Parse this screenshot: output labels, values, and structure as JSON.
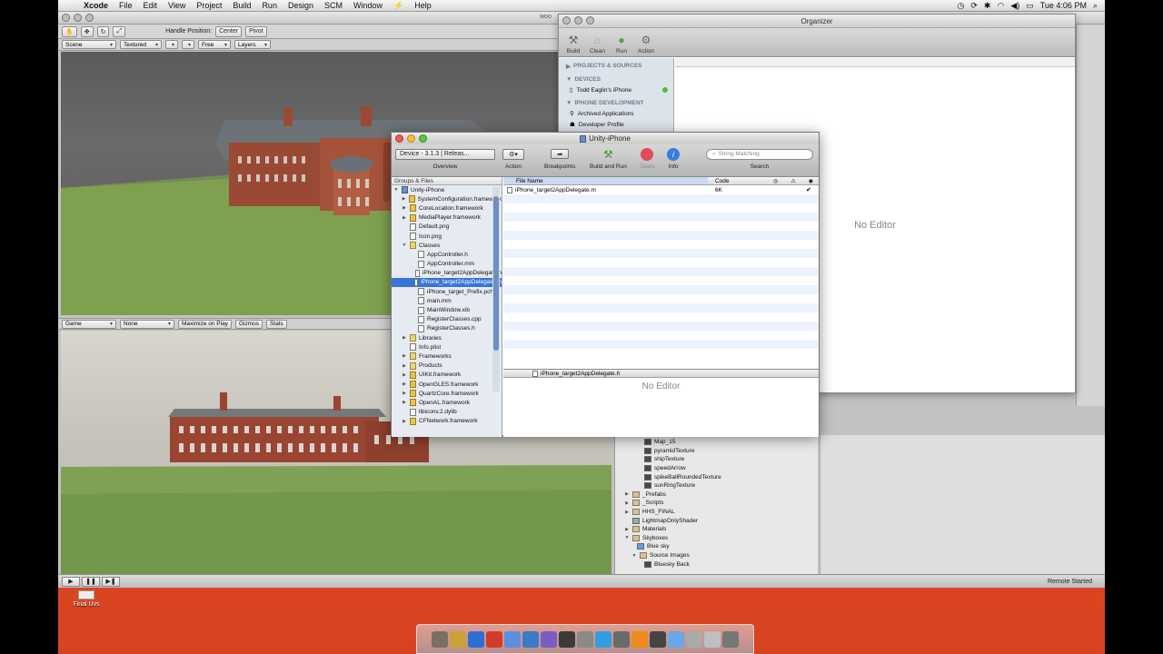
{
  "menubar": {
    "app": "Xcode",
    "items": [
      "File",
      "Edit",
      "View",
      "Project",
      "Build",
      "Run",
      "Design",
      "SCM",
      "Window",
      "Help"
    ],
    "clock": "Tue 4:06 PM"
  },
  "unity": {
    "tab_title": "woo",
    "handle_position_label": "Handle Position:",
    "center_btn": "Center",
    "pivot_btn": "Pivot",
    "scene_view": {
      "mode": "Scene",
      "shading": "Textured",
      "free": "Free",
      "layers": "Layers"
    },
    "game_view": {
      "mode": "Game",
      "aspect": "None",
      "maximize": "Maximize on Play",
      "gizmos": "Gizmos",
      "stats": "Stats"
    },
    "status": "Remote Started",
    "project_items": [
      {
        "label": "Map_15",
        "kind": "tex"
      },
      {
        "label": "pyramidTexture",
        "kind": "tex"
      },
      {
        "label": "shipTexture",
        "kind": "tex"
      },
      {
        "label": "speedArrow",
        "kind": "tex"
      },
      {
        "label": "spikeBallRoundedTexture",
        "kind": "tex"
      },
      {
        "label": "sunRingTexture",
        "kind": "tex"
      },
      {
        "label": "_Prefabs",
        "kind": "folder"
      },
      {
        "label": "_Scripts",
        "kind": "folder"
      },
      {
        "label": "HHS_FINAL",
        "kind": "folder"
      },
      {
        "label": "LightmapOnlyShader",
        "kind": "file"
      },
      {
        "label": "Materials",
        "kind": "folder"
      },
      {
        "label": "Skyboxes",
        "kind": "folder"
      },
      {
        "label": "Blue sky",
        "kind": "file"
      },
      {
        "label": "Source Images",
        "kind": "folder"
      },
      {
        "label": "Bluesky Back",
        "kind": "tex"
      }
    ]
  },
  "organizer": {
    "title": "Organizer",
    "toolbar": [
      "Build",
      "Clean",
      "Run",
      "Action"
    ],
    "sections": {
      "projects": "PROJECTS & SOURCES",
      "devices": "DEVICES",
      "device_item": "Todd Eaglin's iPhone",
      "iphone_dev": "IPHONE DEVELOPMENT",
      "archived": "Archived Applications",
      "profile": "Developer Profile"
    },
    "no_editor": "No Editor"
  },
  "xcode": {
    "title": "Unity-iPhone",
    "device_selector": "Device - 3.1.3 | Releas...",
    "toolbar": {
      "overview": "Overview",
      "action": "Action",
      "breakpoints": "Breakpoints",
      "build_run": "Build and Run",
      "tasks": "Tasks",
      "info": "Info",
      "search": "Search",
      "search_placeholder": "String Matching"
    },
    "groups_header": "Groups & Files",
    "tree": [
      {
        "label": "Unity-iPhone",
        "indent": 0,
        "icon": "proj",
        "tri": "▼"
      },
      {
        "label": "SystemConfiguration.framework",
        "indent": 1,
        "icon": "fw",
        "tri": "▶"
      },
      {
        "label": "CoreLocation.framework",
        "indent": 1,
        "icon": "fw",
        "tri": "▶"
      },
      {
        "label": "MediaPlayer.framework",
        "indent": 1,
        "icon": "fw",
        "tri": "▶"
      },
      {
        "label": "Default.png",
        "indent": 1,
        "icon": "file",
        "tri": ""
      },
      {
        "label": "Icon.png",
        "indent": 1,
        "icon": "file",
        "tri": ""
      },
      {
        "label": "Classes",
        "indent": 1,
        "icon": "fold",
        "tri": "▼"
      },
      {
        "label": "AppController.h",
        "indent": 2,
        "icon": "file",
        "tri": ""
      },
      {
        "label": "AppController.mm",
        "indent": 2,
        "icon": "file",
        "tri": ""
      },
      {
        "label": "iPhone_target2AppDelegate.h",
        "indent": 2,
        "icon": "file",
        "tri": ""
      },
      {
        "label": "iPhone_target2AppDelegate.m",
        "indent": 2,
        "icon": "file",
        "tri": "",
        "selected": true
      },
      {
        "label": "iPhone_target_Prefix.pch",
        "indent": 2,
        "icon": "file",
        "tri": ""
      },
      {
        "label": "main.mm",
        "indent": 2,
        "icon": "file",
        "tri": ""
      },
      {
        "label": "MainWindow.xib",
        "indent": 2,
        "icon": "file",
        "tri": ""
      },
      {
        "label": "RegisterClasses.cpp",
        "indent": 2,
        "icon": "file",
        "tri": ""
      },
      {
        "label": "RegisterClasses.h",
        "indent": 2,
        "icon": "file",
        "tri": ""
      },
      {
        "label": "Libraries",
        "indent": 1,
        "icon": "fold",
        "tri": "▶"
      },
      {
        "label": "Info.plist",
        "indent": 1,
        "icon": "file",
        "tri": ""
      },
      {
        "label": "Frameworks",
        "indent": 1,
        "icon": "fold",
        "tri": "▶"
      },
      {
        "label": "Products",
        "indent": 1,
        "icon": "fold",
        "tri": "▶"
      },
      {
        "label": "UIKit.framework",
        "indent": 1,
        "icon": "fw",
        "tri": "▶"
      },
      {
        "label": "OpenGLES.framework",
        "indent": 1,
        "icon": "fw",
        "tri": "▶"
      },
      {
        "label": "QuartzCore.framework",
        "indent": 1,
        "icon": "fw",
        "tri": "▶"
      },
      {
        "label": "OpenAL.framework",
        "indent": 1,
        "icon": "fw",
        "tri": "▶"
      },
      {
        "label": "libiconv.2.dylib",
        "indent": 1,
        "icon": "file",
        "tri": ""
      },
      {
        "label": "CFNetwork.framework",
        "indent": 1,
        "icon": "fw",
        "tri": "▶"
      }
    ],
    "table": {
      "col_file": "File Name",
      "col_code": "Code",
      "rows": [
        {
          "name": "iPhone_target2AppDelegate.m",
          "code": "6K"
        }
      ]
    },
    "editor_file": "iPhone_target2AppDelegate.h",
    "no_editor": "No Editor"
  },
  "desktop": {
    "icon_label": "Final Uvs"
  },
  "dock_colors": [
    "#7a6f62",
    "#c9a13a",
    "#2d6fd1",
    "#d23b2b",
    "#5b8fe0",
    "#3b7ac9",
    "#7a5dc4",
    "#3a3a3a",
    "#8a8a8a",
    "#2f9fe0",
    "#6a6a6a",
    "#f08a1a",
    "#444444",
    "#6aa7e8",
    "#aaaaaa",
    "#bfbfbf",
    "#777777"
  ]
}
